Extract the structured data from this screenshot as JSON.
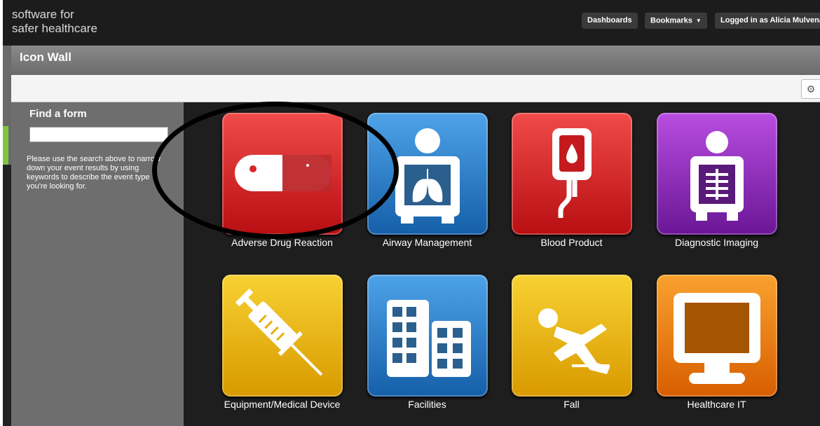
{
  "brand": {
    "text": "software for\nsafer healthcare"
  },
  "nav": {
    "dashboards": "Dashboards",
    "bookmarks": "Bookmarks",
    "user": "Logged in as Alicia Mulvena"
  },
  "panel": {
    "title": "Icon Wall"
  },
  "sidebar": {
    "heading": "Find a form",
    "search_value": "",
    "help": "Please use the search above to narrow down your event results by using keywords to describe the event type you're looking for."
  },
  "tiles": [
    {
      "label": "Adverse Drug Reaction",
      "icon": "pill-icon",
      "color": "#d62528"
    },
    {
      "label": "Airway Management",
      "icon": "lung-xray-icon",
      "color": "#2d7fcc"
    },
    {
      "label": "Blood Product",
      "icon": "blood-bag-icon",
      "color": "#d62528"
    },
    {
      "label": "Diagnostic Imaging",
      "icon": "xray-person-icon",
      "color": "#9b30c9"
    },
    {
      "label": "Equipment/Medical Device",
      "icon": "syringe-icon",
      "color": "#e8b00c"
    },
    {
      "label": "Facilities",
      "icon": "buildings-icon",
      "color": "#2d7fcc"
    },
    {
      "label": "Fall",
      "icon": "falling-person-icon",
      "color": "#e8b00c"
    },
    {
      "label": "Healthcare IT",
      "icon": "monitor-icon",
      "color": "#f07d10"
    }
  ]
}
